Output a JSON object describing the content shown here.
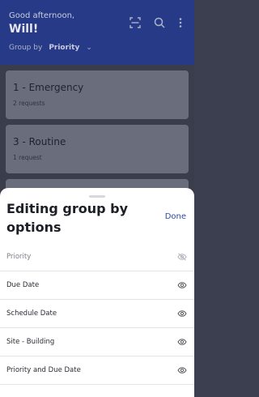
{
  "header": {
    "greeting": "Good afternoon,",
    "user_name": "Will!",
    "group_by_label": "Group by",
    "group_by_value": "Priority"
  },
  "groups": [
    {
      "title": "1 - Emergency",
      "count": "2 requests"
    },
    {
      "title": "3 - Routine",
      "count": "1 request"
    }
  ],
  "sheet": {
    "title": "Editing group by options",
    "done_label": "Done",
    "options": [
      {
        "label": "Priority",
        "visible": false
      },
      {
        "label": "Due Date",
        "visible": true
      },
      {
        "label": "Schedule Date",
        "visible": true
      },
      {
        "label": "Site - Building",
        "visible": true
      },
      {
        "label": "Priority and Due Date",
        "visible": true
      }
    ]
  },
  "colors": {
    "header_bg": "#263a87",
    "accent": "#2c4aa8",
    "sheet_bg": "#ffffff"
  },
  "icons": {
    "scan": "barcode-scan-icon",
    "search": "search-icon",
    "more": "more-vertical-icon",
    "visible": "eye-icon",
    "hidden": "eye-off-icon"
  }
}
